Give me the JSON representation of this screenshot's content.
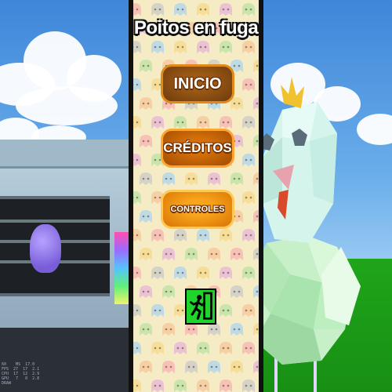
{
  "game": {
    "title": "Poitos en fuga"
  },
  "menu": {
    "start_label": "INICIO",
    "credits_label": "CRÉDITOS",
    "controls_label": "CONTROLES",
    "exit_icon": "exit-running-person-icon"
  },
  "debug_overlay": {
    "text": "60    MS  17.0\nFPS  27  17  2.1\nCPU  17  12  2.9\nGPU   7   0  2.8\nDRAW"
  },
  "colors": {
    "panel_bg": "#f5ebc4",
    "start_button": "#9c5a16",
    "credits_button": "#d46f0a",
    "controls_button": "#f8a41c",
    "exit_button": "#1fd42b"
  }
}
